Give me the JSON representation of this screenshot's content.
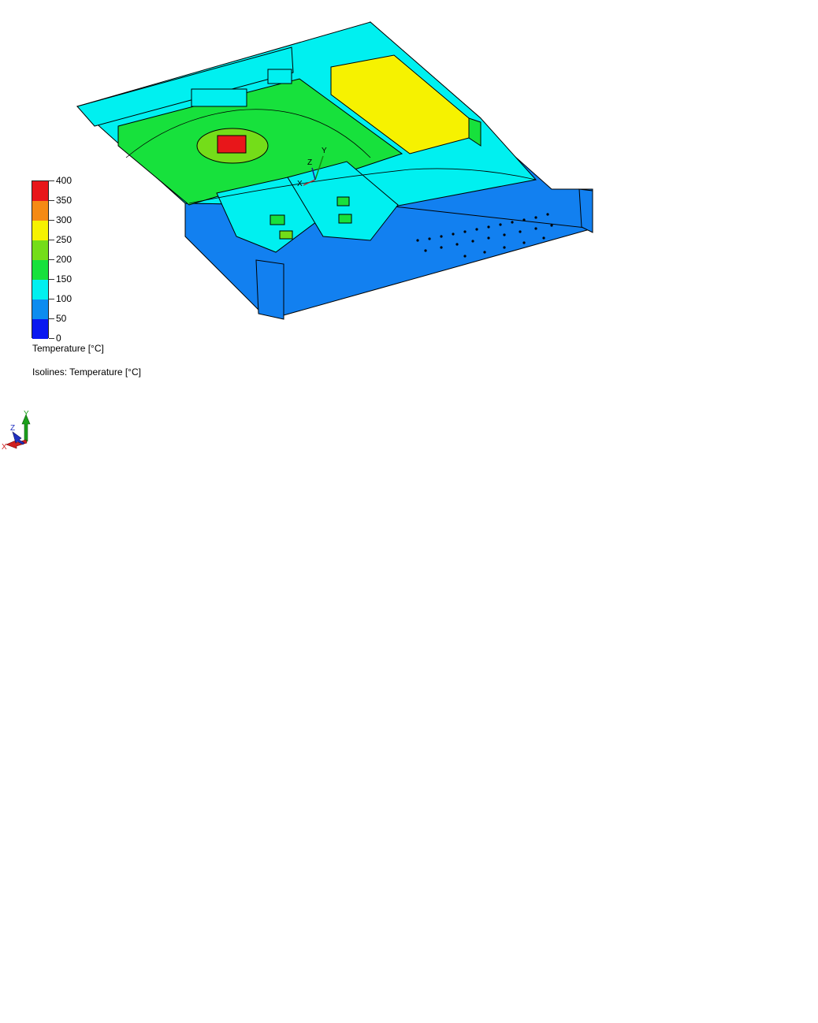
{
  "legend": {
    "ticks": [
      "400",
      "350",
      "300",
      "250",
      "200",
      "150",
      "100",
      "50",
      "0"
    ],
    "bands": [
      "#e8161a",
      "#f58a14",
      "#f6f200",
      "#74dd19",
      "#17e13c",
      "#00f0f0",
      "#0c8cf0",
      "#0a18f0"
    ],
    "title": "Temperature [°C]",
    "isolines": "Isolines: Temperature [°C]"
  },
  "axes": {
    "x_label": "X",
    "y_label": "Y",
    "z_label": "Z"
  },
  "colors": {
    "chassis_cool": "#1280f0",
    "panel_cyan": "#00f0f0",
    "board_green": "#17e13c",
    "psu_yellow": "#f6f200",
    "cpu_red": "#e8161a"
  }
}
